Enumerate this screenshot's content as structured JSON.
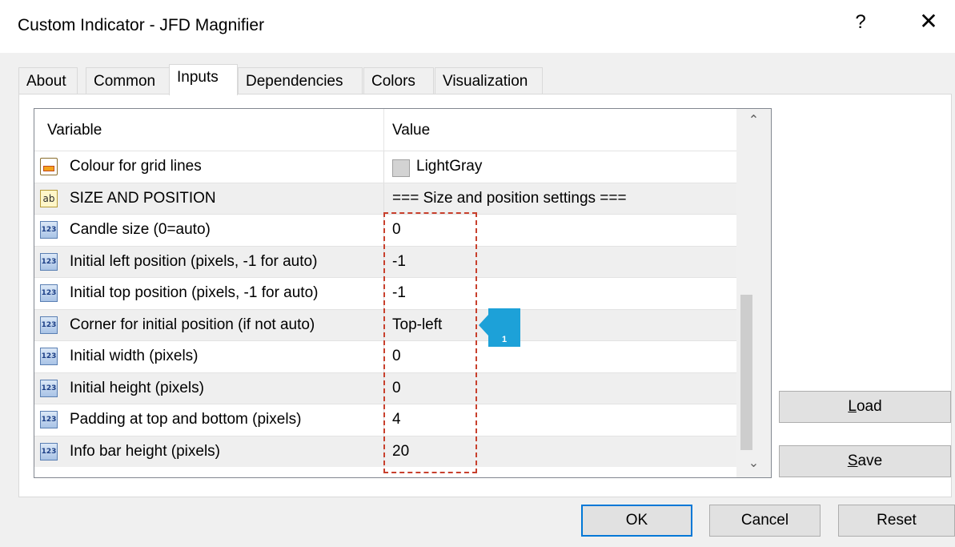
{
  "window": {
    "title": "Custom Indicator - JFD Magnifier",
    "help": "?",
    "close": "✕"
  },
  "tabs": [
    {
      "label": "About"
    },
    {
      "label": "Common"
    },
    {
      "label": "Inputs"
    },
    {
      "label": "Dependencies"
    },
    {
      "label": "Colors"
    },
    {
      "label": "Visualization"
    }
  ],
  "active_tab": "Inputs",
  "grid": {
    "columns": [
      "Variable",
      "Value"
    ],
    "rows": [
      {
        "icon": "color-icon",
        "name": "Colour for grid lines",
        "value": "LightGray",
        "swatch": "#d3d3d3"
      },
      {
        "icon": "string-icon",
        "icon_text": "ab",
        "name": "SIZE AND POSITION",
        "value": "=== Size and position settings ==="
      },
      {
        "icon": "number-icon",
        "icon_text": "123",
        "name": "Candle size (0=auto)",
        "value": "0"
      },
      {
        "icon": "number-icon",
        "icon_text": "123",
        "name": "Initial left position (pixels, -1 for auto)",
        "value": "-1"
      },
      {
        "icon": "number-icon",
        "icon_text": "123",
        "name": "Initial top position (pixels, -1 for auto)",
        "value": "-1"
      },
      {
        "icon": "number-icon",
        "icon_text": "123",
        "name": "Corner for initial position (if not auto)",
        "value": "Top-left"
      },
      {
        "icon": "number-icon",
        "icon_text": "123",
        "name": "Initial width (pixels)",
        "value": "0"
      },
      {
        "icon": "number-icon",
        "icon_text": "123",
        "name": "Initial height (pixels)",
        "value": "0"
      },
      {
        "icon": "number-icon",
        "icon_text": "123",
        "name": "Padding at top and bottom (pixels)",
        "value": "4"
      },
      {
        "icon": "number-icon",
        "icon_text": "123",
        "name": "Info bar height (pixels)",
        "value": "20"
      }
    ]
  },
  "callout": {
    "label": "1",
    "color": "#1da1d8"
  },
  "highlight_color": "#c8402d",
  "buttons": {
    "load": {
      "label": "Load",
      "mnemonic": "L",
      "rest": "oad"
    },
    "save": {
      "label": "Save",
      "mnemonic": "S",
      "rest": "ave"
    },
    "ok": "OK",
    "cancel": "Cancel",
    "reset": "Reset"
  }
}
